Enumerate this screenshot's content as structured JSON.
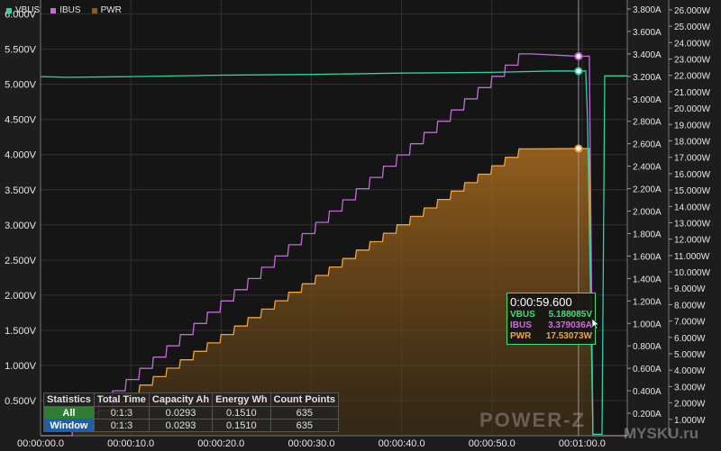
{
  "chart_data": {
    "type": "line",
    "title": "",
    "xlabel": "",
    "x_ticks": [
      "00:00:00.0",
      "00:00:10.0",
      "00:00:20.0",
      "00:00:30.0",
      "00:00:40.0",
      "00:00:50.0",
      "00:01:00.0"
    ],
    "xlim": [
      0,
      65
    ],
    "y_left": {
      "ticks": [
        "0.500V",
        "1.000V",
        "1.500V",
        "2.000V",
        "2.500V",
        "3.000V",
        "3.500V",
        "4.000V",
        "4.500V",
        "5.000V",
        "5.500V",
        "6.000V"
      ],
      "lim": [
        0,
        6.2
      ],
      "unit": "V"
    },
    "y_right1": {
      "ticks": [
        "0.200A",
        "0.400A",
        "0.600A",
        "0.800A",
        "1.000A",
        "1.200A",
        "1.400A",
        "1.600A",
        "1.800A",
        "2.000A",
        "2.200A",
        "2.400A",
        "2.600A",
        "2.800A",
        "3.000A",
        "3.200A",
        "3.400A",
        "3.600A",
        "3.800A"
      ],
      "lim": [
        0,
        3.88
      ],
      "unit": "A"
    },
    "y_right2": {
      "ticks": [
        "1.000W",
        "2.000W",
        "3.000W",
        "4.000W",
        "5.000W",
        "6.000W",
        "7.000W",
        "8.000W",
        "9.000W",
        "10.000W",
        "11.000W",
        "12.000W",
        "13.000W",
        "14.000W",
        "15.000W",
        "16.000W",
        "17.000W",
        "18.000W",
        "19.000W",
        "20.000W",
        "21.000W",
        "22.000W",
        "23.000W",
        "24.000W",
        "25.000W",
        "26.000W"
      ],
      "lim": [
        0,
        26.6
      ],
      "unit": "W"
    },
    "grid": true,
    "legend_position": "top-left",
    "series": [
      {
        "name": "VBUS",
        "axis": "V",
        "color": "#2ed3a6",
        "points": [
          [
            0,
            5.11
          ],
          [
            3,
            5.1
          ],
          [
            10,
            5.11
          ],
          [
            20,
            5.13
          ],
          [
            30,
            5.14
          ],
          [
            40,
            5.16
          ],
          [
            50,
            5.17
          ],
          [
            57,
            5.19
          ],
          [
            59.6,
            5.188
          ],
          [
            60.4,
            5.19
          ],
          [
            60.6,
            4.5
          ],
          [
            61.2,
            0.02
          ],
          [
            62.2,
            0.02
          ],
          [
            62.5,
            5.12
          ],
          [
            65,
            5.12
          ]
        ]
      },
      {
        "name": "IBUS",
        "axis": "A",
        "color": "#c46ad8",
        "ramp": {
          "start_t": 3.5,
          "step_dt": 1.5,
          "step_dA": 0.1,
          "steps": 34,
          "end_t": 59.6,
          "end_value": 3.379
        },
        "after": [
          [
            60.8,
            3.38
          ],
          [
            61.2,
            0.0
          ],
          [
            65,
            0.0
          ]
        ]
      },
      {
        "name": "PWR",
        "axis": "W",
        "color": "#f2a23a",
        "ramp": {
          "start_t": 3.5,
          "step_dt": 1.5,
          "step_dW": 0.515,
          "steps": 34,
          "end_t": 59.6,
          "end_value": 17.53
        },
        "after": [
          [
            60.8,
            17.53
          ],
          [
            61.2,
            0.0
          ],
          [
            65,
            0.0
          ]
        ]
      }
    ],
    "cursor_time": 59.6,
    "tooltip": {
      "time": "0:00:59.600",
      "rows": [
        {
          "label": "VBUS",
          "value": "5.188085V",
          "color": "#3be071"
        },
        {
          "label": "IBUS",
          "value": "3.379036A",
          "color": "#d06ae0"
        },
        {
          "label": "PWR",
          "value": "17.53073W",
          "color": "#f2a23a"
        }
      ]
    }
  },
  "legend": [
    {
      "name": "VBUS",
      "color": "#2ed3a6"
    },
    {
      "name": "IBUS",
      "color": "#c46ad8"
    },
    {
      "name": "PWR",
      "color": "#8a5a1a"
    }
  ],
  "stats": {
    "headers": [
      "Statistics",
      "Total Time",
      "Capacity Ah",
      "Energy Wh",
      "Count Points"
    ],
    "rows": [
      {
        "label": "All",
        "total_time": "0:1:3",
        "capacity": "0.0293",
        "energy": "0.1510",
        "count": "635"
      },
      {
        "label": "Window",
        "total_time": "0:1:3",
        "capacity": "0.0293",
        "energy": "0.1510",
        "count": "635"
      }
    ]
  },
  "watermark": "POWER-Z",
  "watermark2": "MYSKU.ru"
}
